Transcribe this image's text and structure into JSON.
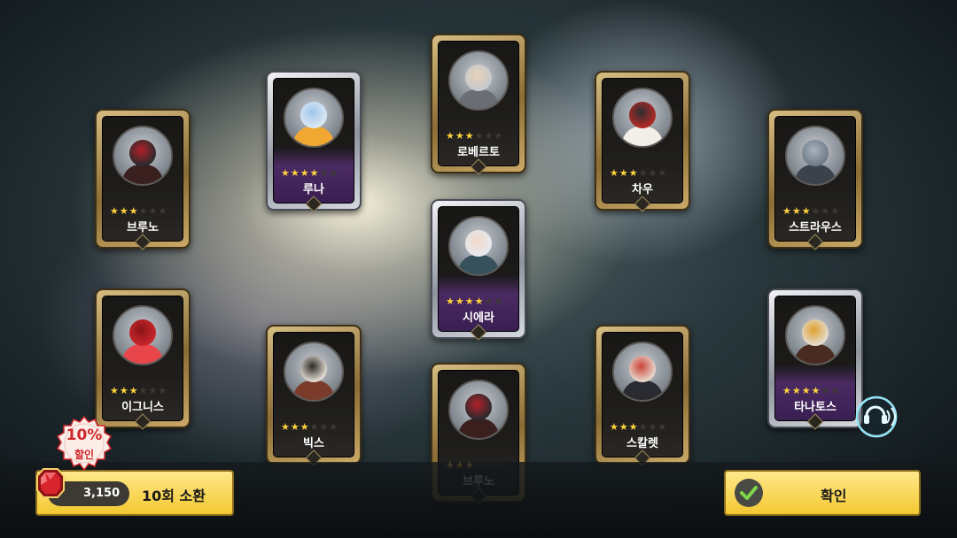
{
  "cards": [
    {
      "id": "bruno-1",
      "name": "브루노",
      "stars": 3,
      "frame": "gold",
      "palette": {
        "head": "#2a2a2c",
        "body": "#3a1f1f",
        "accent": "#b3202a"
      }
    },
    {
      "id": "luna",
      "name": "루나",
      "stars": 4,
      "frame": "silver",
      "palette": {
        "head": "#dce8f5",
        "body": "#f0a832",
        "accent": "#9fc6ea"
      }
    },
    {
      "id": "roberto",
      "name": "로베르토",
      "stars": 3,
      "frame": "gold",
      "palette": {
        "head": "#c5c9ce",
        "body": "#6a6d73",
        "accent": "#e8d3b8"
      }
    },
    {
      "id": "chau",
      "name": "차우",
      "stars": 3,
      "frame": "gold",
      "palette": {
        "head": "#b32a24",
        "body": "#f2eee8",
        "accent": "#2e2e32"
      }
    },
    {
      "id": "strauss",
      "name": "스트라우스",
      "stars": 3,
      "frame": "gold",
      "palette": {
        "head": "#6f7a86",
        "body": "#3b424b",
        "accent": "#a7b3bf"
      }
    },
    {
      "id": "siera",
      "name": "시에라",
      "stars": 4,
      "frame": "silver",
      "palette": {
        "head": "#e6e9ef",
        "body": "#36505c",
        "accent": "#f1d8c8"
      }
    },
    {
      "id": "ignis",
      "name": "이그니스",
      "stars": 3,
      "frame": "gold",
      "palette": {
        "head": "#c8262a",
        "body": "#e8464a",
        "accent": "#8a1418"
      }
    },
    {
      "id": "bix",
      "name": "빅스",
      "stars": 3,
      "frame": "gold",
      "palette": {
        "head": "#e2ddd2",
        "body": "#7a3b2a",
        "accent": "#2f2a28"
      }
    },
    {
      "id": "bruno-2",
      "name": "브루노",
      "stars": 3,
      "frame": "gold",
      "palette": {
        "head": "#2a2a2c",
        "body": "#3a1f1f",
        "accent": "#b3202a"
      }
    },
    {
      "id": "scarlet",
      "name": "스칼렛",
      "stars": 3,
      "frame": "gold",
      "palette": {
        "head": "#e9d8cc",
        "body": "#2a2b30",
        "accent": "#c9443a"
      }
    },
    {
      "id": "thanatos",
      "name": "타나토스",
      "stars": 4,
      "frame": "silver",
      "palette": {
        "head": "#e4dccf",
        "body": "#4a2b22",
        "accent": "#e0a030"
      }
    }
  ],
  "summon": {
    "discount_percent": "10%",
    "discount_label": "할인",
    "cost": "3,150",
    "label": "10회 소환",
    "gem_color": "#d8242c"
  },
  "confirm": {
    "label": "확인"
  },
  "icons": {
    "gem": "ruby-gem-icon",
    "check": "check-icon",
    "chat": "voice-chat-icon",
    "star": "star-icon"
  },
  "colors": {
    "button_yellow": "#f6d23e",
    "star_gold": "#ffd23c",
    "discount_red": "#d0262a"
  }
}
